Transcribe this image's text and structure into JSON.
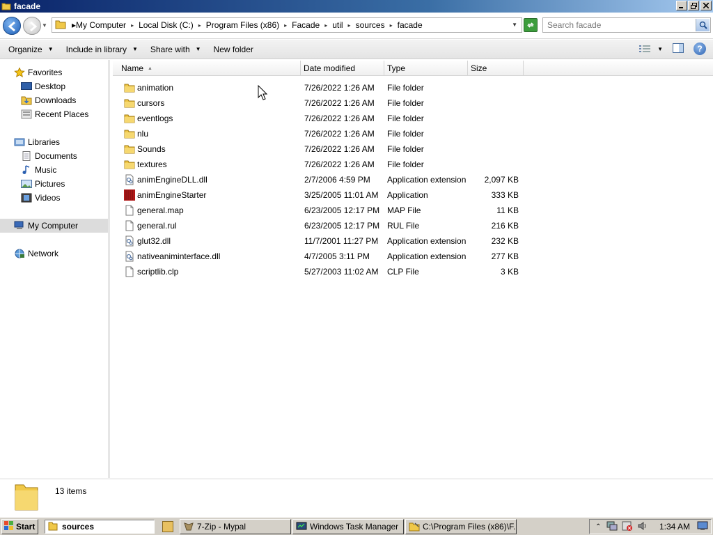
{
  "window": {
    "title": "facade"
  },
  "address": {
    "crumbs": [
      "My Computer",
      "Local Disk (C:)",
      "Program Files (x86)",
      "Facade",
      "util",
      "sources",
      "facade"
    ]
  },
  "search": {
    "placeholder": "Search facade"
  },
  "toolbar": {
    "organize": "Organize",
    "include_in_library": "Include in library",
    "share_with": "Share with",
    "new_folder": "New folder"
  },
  "nav": {
    "favorites": "Favorites",
    "desktop": "Desktop",
    "downloads": "Downloads",
    "recent_places": "Recent Places",
    "libraries": "Libraries",
    "documents": "Documents",
    "music": "Music",
    "pictures": "Pictures",
    "videos": "Videos",
    "my_computer": "My Computer",
    "network": "Network"
  },
  "columns": {
    "name": "Name",
    "date_modified": "Date modified",
    "type": "Type",
    "size": "Size"
  },
  "files": [
    {
      "name": "animation",
      "date": "7/26/2022 1:26 AM",
      "type": "File folder",
      "size": "",
      "icon": "folder-icon"
    },
    {
      "name": "cursors",
      "date": "7/26/2022 1:26 AM",
      "type": "File folder",
      "size": "",
      "icon": "folder-icon"
    },
    {
      "name": "eventlogs",
      "date": "7/26/2022 1:26 AM",
      "type": "File folder",
      "size": "",
      "icon": "folder-icon"
    },
    {
      "name": "nlu",
      "date": "7/26/2022 1:26 AM",
      "type": "File folder",
      "size": "",
      "icon": "folder-icon"
    },
    {
      "name": "Sounds",
      "date": "7/26/2022 1:26 AM",
      "type": "File folder",
      "size": "",
      "icon": "folder-icon"
    },
    {
      "name": "textures",
      "date": "7/26/2022 1:26 AM",
      "type": "File folder",
      "size": "",
      "icon": "folder-icon"
    },
    {
      "name": "animEngineDLL.dll",
      "date": "2/7/2006 4:59 PM",
      "type": "Application extension",
      "size": "2,097 KB",
      "icon": "dll-icon"
    },
    {
      "name": "animEngineStarter",
      "date": "3/25/2005 11:01 AM",
      "type": "Application",
      "size": "333 KB",
      "icon": "app-icon"
    },
    {
      "name": "general.map",
      "date": "6/23/2005 12:17 PM",
      "type": "MAP File",
      "size": "11 KB",
      "icon": "file-icon"
    },
    {
      "name": "general.rul",
      "date": "6/23/2005 12:17 PM",
      "type": "RUL File",
      "size": "216 KB",
      "icon": "file-icon"
    },
    {
      "name": "glut32.dll",
      "date": "11/7/2001 11:27 PM",
      "type": "Application extension",
      "size": "232 KB",
      "icon": "dll-icon"
    },
    {
      "name": "nativeaniminterface.dll",
      "date": "4/7/2005 3:11 PM",
      "type": "Application extension",
      "size": "277 KB",
      "icon": "dll-icon"
    },
    {
      "name": "scriptlib.clp",
      "date": "5/27/2003 11:02 AM",
      "type": "CLP File",
      "size": "3 KB",
      "icon": "file-icon"
    }
  ],
  "status": {
    "count": "13 items"
  },
  "taskbar": {
    "start": "Start",
    "address_input": "sources",
    "tasks": [
      {
        "label": "7-Zip - Mypal",
        "icon": "7zip-icon"
      },
      {
        "label": "Windows Task Manager",
        "icon": "task-manager-icon"
      },
      {
        "label": "C:\\Program Files (x86)\\F...",
        "icon": "explorer-icon"
      }
    ],
    "clock": "1:34 AM"
  }
}
